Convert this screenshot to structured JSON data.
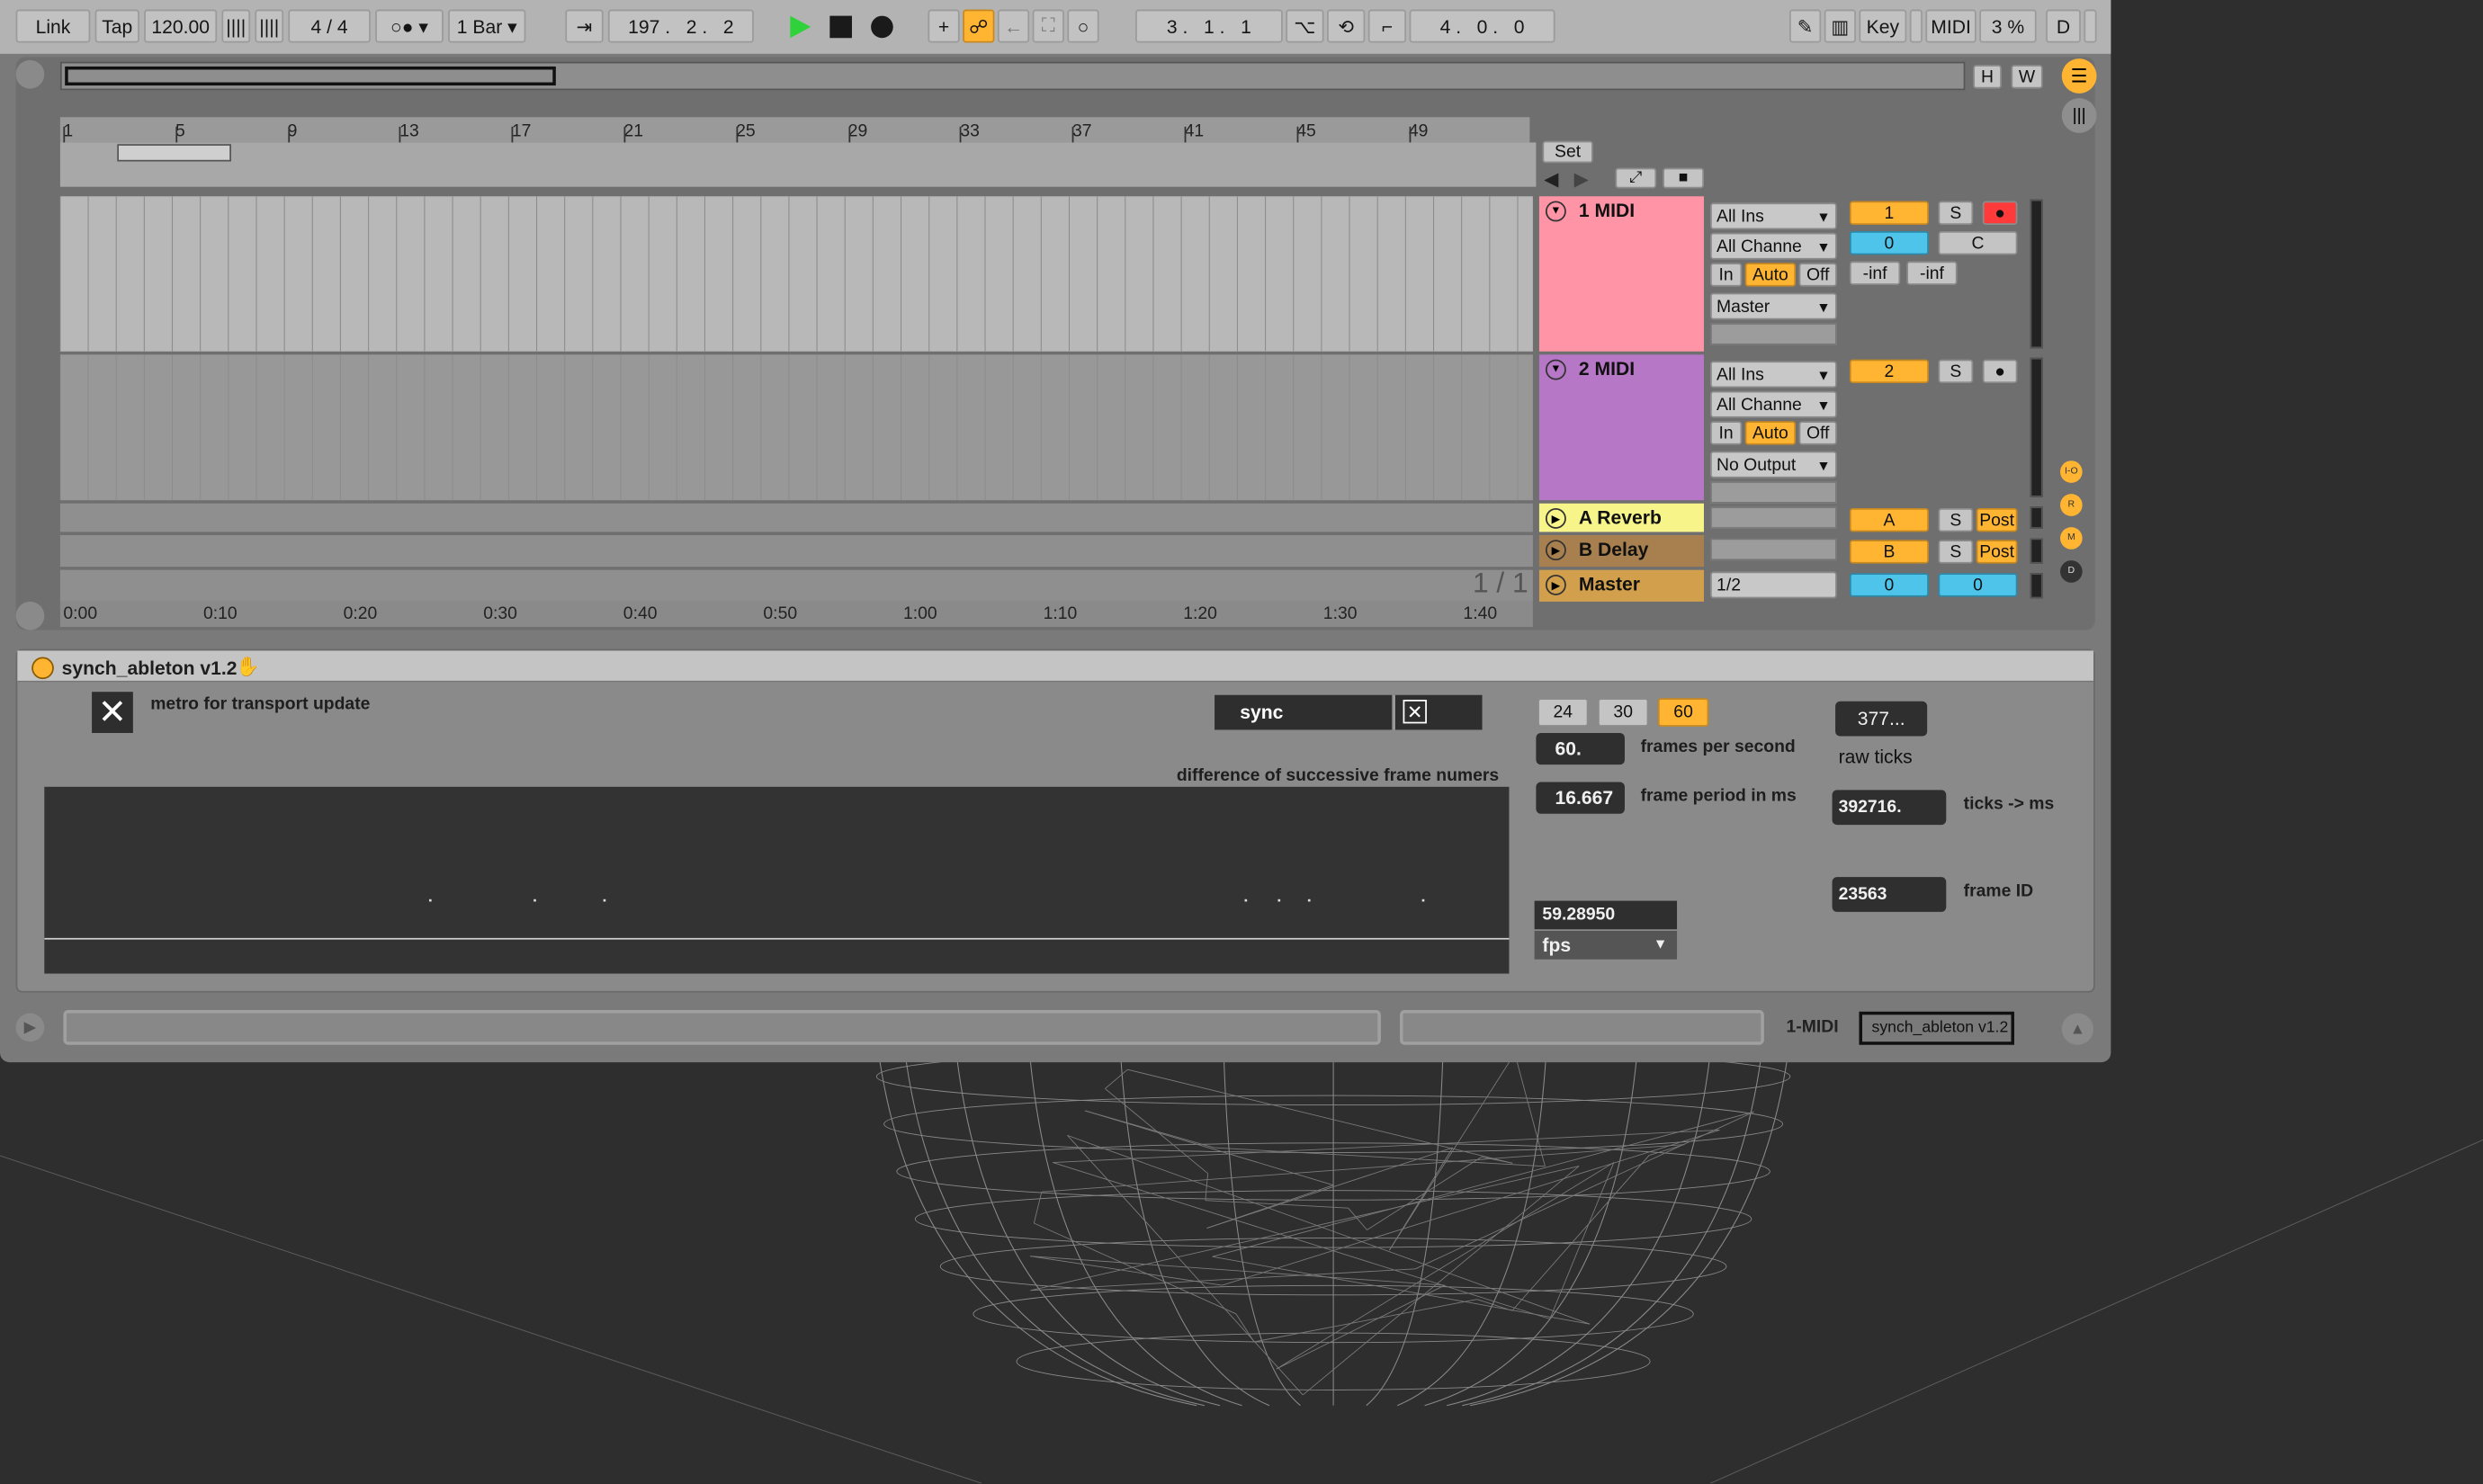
{
  "transport": {
    "link": "Link",
    "tap": "Tap",
    "tempo": "120.00",
    "signature": "4 / 4",
    "quantize": "1 Bar",
    "arrangement_position": "197 .   2 .   2",
    "loop_start": "3 .   1 .   1",
    "loop_length": "4 .   0 .   0",
    "key": "Key",
    "midi": "MIDI",
    "cpu": "3 %",
    "disk": "D",
    "overview_h": "H",
    "overview_w": "W"
  },
  "ruler": {
    "bars": [
      "1",
      "5",
      "9",
      "13",
      "17",
      "21",
      "25",
      "29",
      "33",
      "37",
      "41",
      "45",
      "49"
    ],
    "times": [
      "0:00",
      "0:10",
      "0:20",
      "0:30",
      "0:40",
      "0:50",
      "1:00",
      "1:10",
      "1:20",
      "1:30",
      "1:40"
    ],
    "set": "Set",
    "page": "1 / 1"
  },
  "tracks": [
    {
      "name": "1 MIDI",
      "color": "#ff94a6",
      "input_type": "All Ins",
      "input_channel": "All Channe",
      "monitor": [
        "In",
        "Auto",
        "Off"
      ],
      "output": "Master",
      "number": "1",
      "solo": "S",
      "volume": "0",
      "pan": "C",
      "peak_l": "-inf",
      "peak_r": "-inf"
    },
    {
      "name": "2 MIDI",
      "color": "#b677c6",
      "input_type": "All Ins",
      "input_channel": "All Channe",
      "monitor": [
        "In",
        "Auto",
        "Off"
      ],
      "output": "No Output",
      "number": "2",
      "solo": "S"
    },
    {
      "name": "A Reverb",
      "color": "#f7f48a",
      "number": "A",
      "solo": "S",
      "post": "Post"
    },
    {
      "name": "B Delay",
      "color": "#a8804f",
      "number": "B",
      "solo": "S",
      "post": "Post"
    },
    {
      "name": "Master",
      "color": "#d2a04c",
      "output": "1/2",
      "volume": "0",
      "pan": "0"
    }
  ],
  "side_buttons": [
    "I-O",
    "R",
    "M",
    "D"
  ],
  "device": {
    "title": "synch_ableton v1.2",
    "metro_label": "metro for transport update",
    "sync_label": "sync",
    "graph_label": "difference of successive frame numers",
    "fps_buttons": [
      "24",
      "30",
      "60"
    ],
    "fps_value": "60.",
    "fps_label": "frames per second",
    "period_value": "16.667",
    "period_label": "frame period in ms",
    "raw_ticks_value": "377...",
    "raw_ticks_label": "raw ticks",
    "ticks_ms_value": "392716.",
    "ticks_ms_label": "ticks -> ms",
    "frame_id_value": "23563",
    "frame_id_label": "frame ID",
    "fps_measured": "59.28950",
    "fps_menu": "fps"
  },
  "status": {
    "track": "1-MIDI",
    "device": "synch_ableton v1.2"
  }
}
